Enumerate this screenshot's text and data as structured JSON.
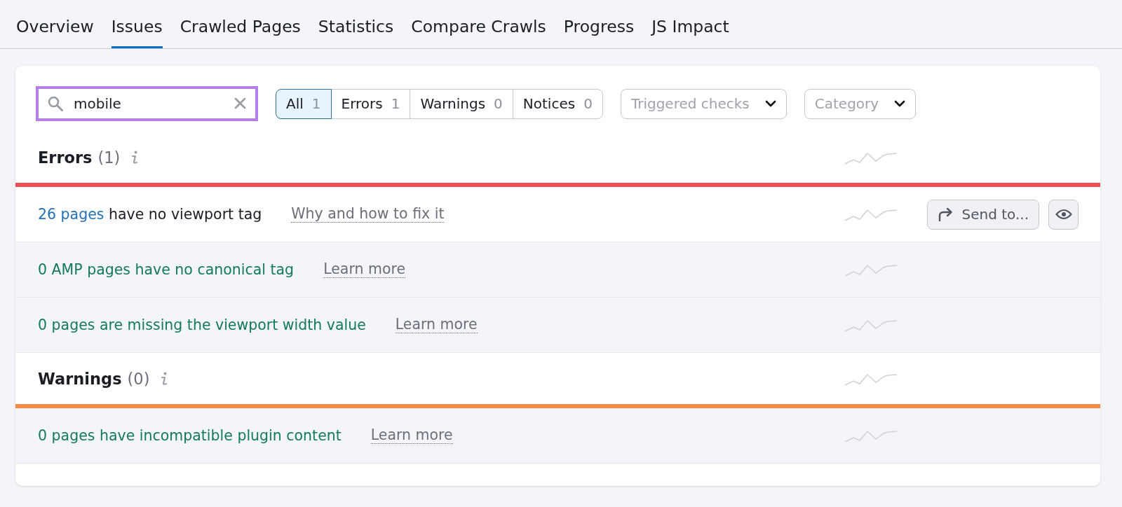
{
  "tabs": [
    {
      "label": "Overview",
      "selected": false
    },
    {
      "label": "Issues",
      "selected": true
    },
    {
      "label": "Crawled Pages",
      "selected": false
    },
    {
      "label": "Statistics",
      "selected": false
    },
    {
      "label": "Compare Crawls",
      "selected": false
    },
    {
      "label": "Progress",
      "selected": false
    },
    {
      "label": "JS Impact",
      "selected": false
    }
  ],
  "search": {
    "value": "mobile"
  },
  "filters": [
    {
      "label": "All",
      "count": "1",
      "selected": true
    },
    {
      "label": "Errors",
      "count": "1",
      "selected": false
    },
    {
      "label": "Warnings",
      "count": "0",
      "selected": false
    },
    {
      "label": "Notices",
      "count": "0",
      "selected": false
    }
  ],
  "dropdowns": [
    {
      "placeholder": "Triggered checks"
    },
    {
      "placeholder": "Category"
    }
  ],
  "sections": [
    {
      "title": "Errors",
      "count": "(1)",
      "color": "#ee4e58",
      "issues": [
        {
          "triggered": true,
          "link": "26 pages",
          "text": "have no viewport tag",
          "help": "Why and how to fix it",
          "actions": [
            {
              "kind": "send",
              "label": "Send to..."
            },
            {
              "kind": "view"
            }
          ]
        },
        {
          "triggered": false,
          "text": "0 AMP pages have no canonical tag",
          "help": "Learn more"
        },
        {
          "triggered": false,
          "text": "0 pages are missing the viewport width value",
          "help": "Learn more"
        }
      ]
    },
    {
      "title": "Warnings",
      "count": "(0)",
      "color": "#f58d45",
      "issues": [
        {
          "triggered": false,
          "text": "0 pages have incompatible plugin content",
          "help": "Learn more"
        }
      ]
    }
  ]
}
